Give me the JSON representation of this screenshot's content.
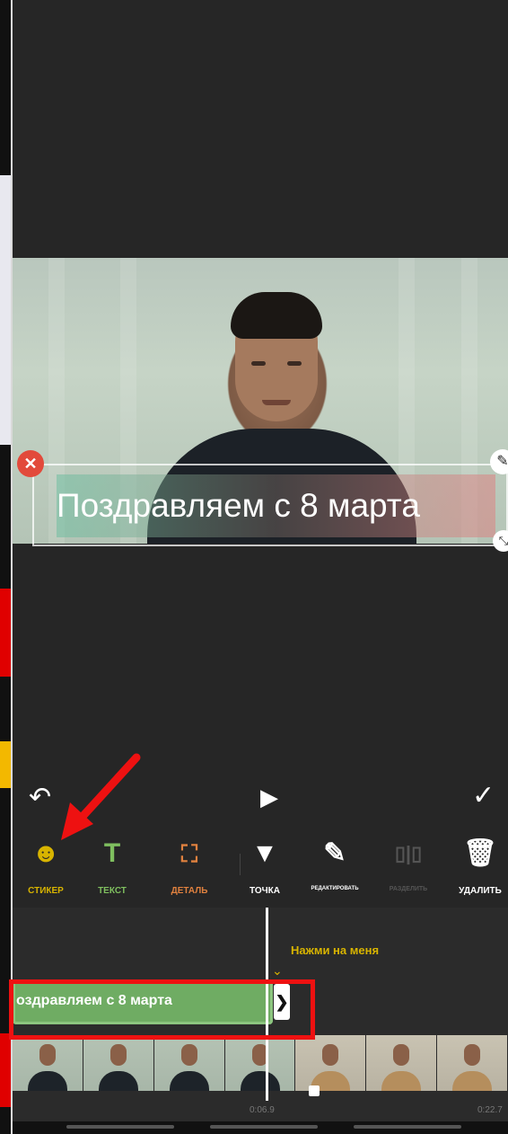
{
  "preview": {
    "caption": "Поздравляем с 8 марта",
    "delete_icon": "close-icon",
    "edit_icon": "pencil-icon",
    "resize_icon": "resize-icon"
  },
  "controls": {
    "undo_icon": "undo-icon",
    "play_icon": "play-icon",
    "confirm_icon": "check-icon"
  },
  "toolbar": {
    "items": [
      {
        "label": "СТИКЕР",
        "icon": "sticker-icon",
        "color": "#d8b400"
      },
      {
        "label": "ТЕКСТ",
        "icon": "text-icon",
        "color": "#7fbf5f"
      },
      {
        "label": "ДЕТАЛЬ",
        "icon": "detail-icon",
        "color": "#e0813f"
      },
      {
        "label": "ТОЧКА",
        "icon": "point-icon",
        "color": "#ffffff"
      },
      {
        "label": "РЕДАКТИРОВАТЬ",
        "icon": "pencil-icon",
        "color": "#ffffff"
      },
      {
        "label": "РАЗДЕЛИТЬ",
        "icon": "split-icon",
        "color": "#555555"
      },
      {
        "label": "УДАЛИТЬ",
        "icon": "trash-icon",
        "color": "#ffffff"
      }
    ]
  },
  "timeline": {
    "hint": "Нажми на меня",
    "sticker_track_label": "оздравляем с 8 марта",
    "current_time": "0:06.9",
    "total_time": "0:22.7"
  },
  "annotation": {
    "color": "#ee1111"
  }
}
